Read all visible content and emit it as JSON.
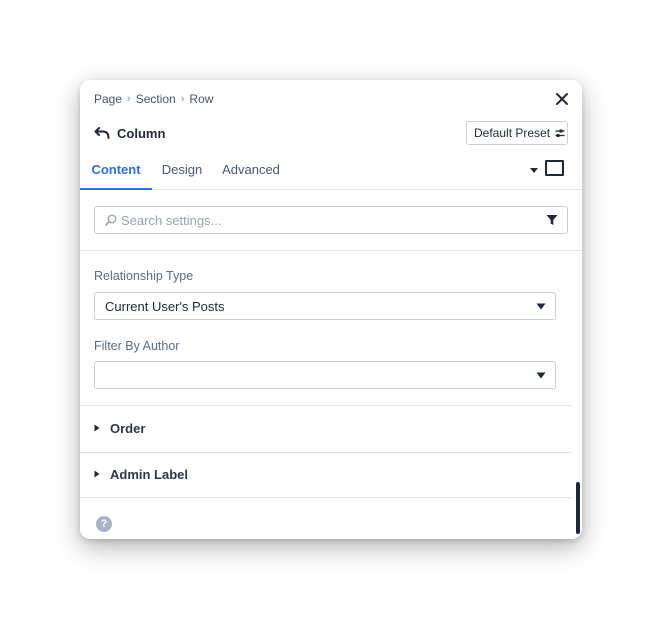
{
  "breadcrumb": {
    "items": [
      "Page",
      "Section",
      "Row"
    ]
  },
  "header": {
    "title": "Column",
    "preset_label": "Default Preset"
  },
  "tabs": [
    {
      "label": "Content",
      "active": true
    },
    {
      "label": "Design",
      "active": false
    },
    {
      "label": "Advanced",
      "active": false
    }
  ],
  "search": {
    "placeholder": "Search settings...",
    "value": ""
  },
  "fields": {
    "relationship_type": {
      "label": "Relationship Type",
      "value": "Current User's Posts"
    },
    "filter_by_author": {
      "label": "Filter By Author",
      "value": ""
    }
  },
  "sections": [
    {
      "label": "Order"
    },
    {
      "label": "Admin Label"
    }
  ],
  "help": {
    "glyph": "?"
  },
  "colors": {
    "accent": "#2f6fde",
    "label": "#5b6c8f",
    "text": "#1f2937",
    "border": "#c9cfdb"
  },
  "icons": [
    "close-icon",
    "back-arrow-icon",
    "preset-settings-icon",
    "caret-down-icon",
    "square-toggle-icon",
    "search-icon",
    "filter-icon",
    "triangle-right-icon",
    "help-icon"
  ]
}
